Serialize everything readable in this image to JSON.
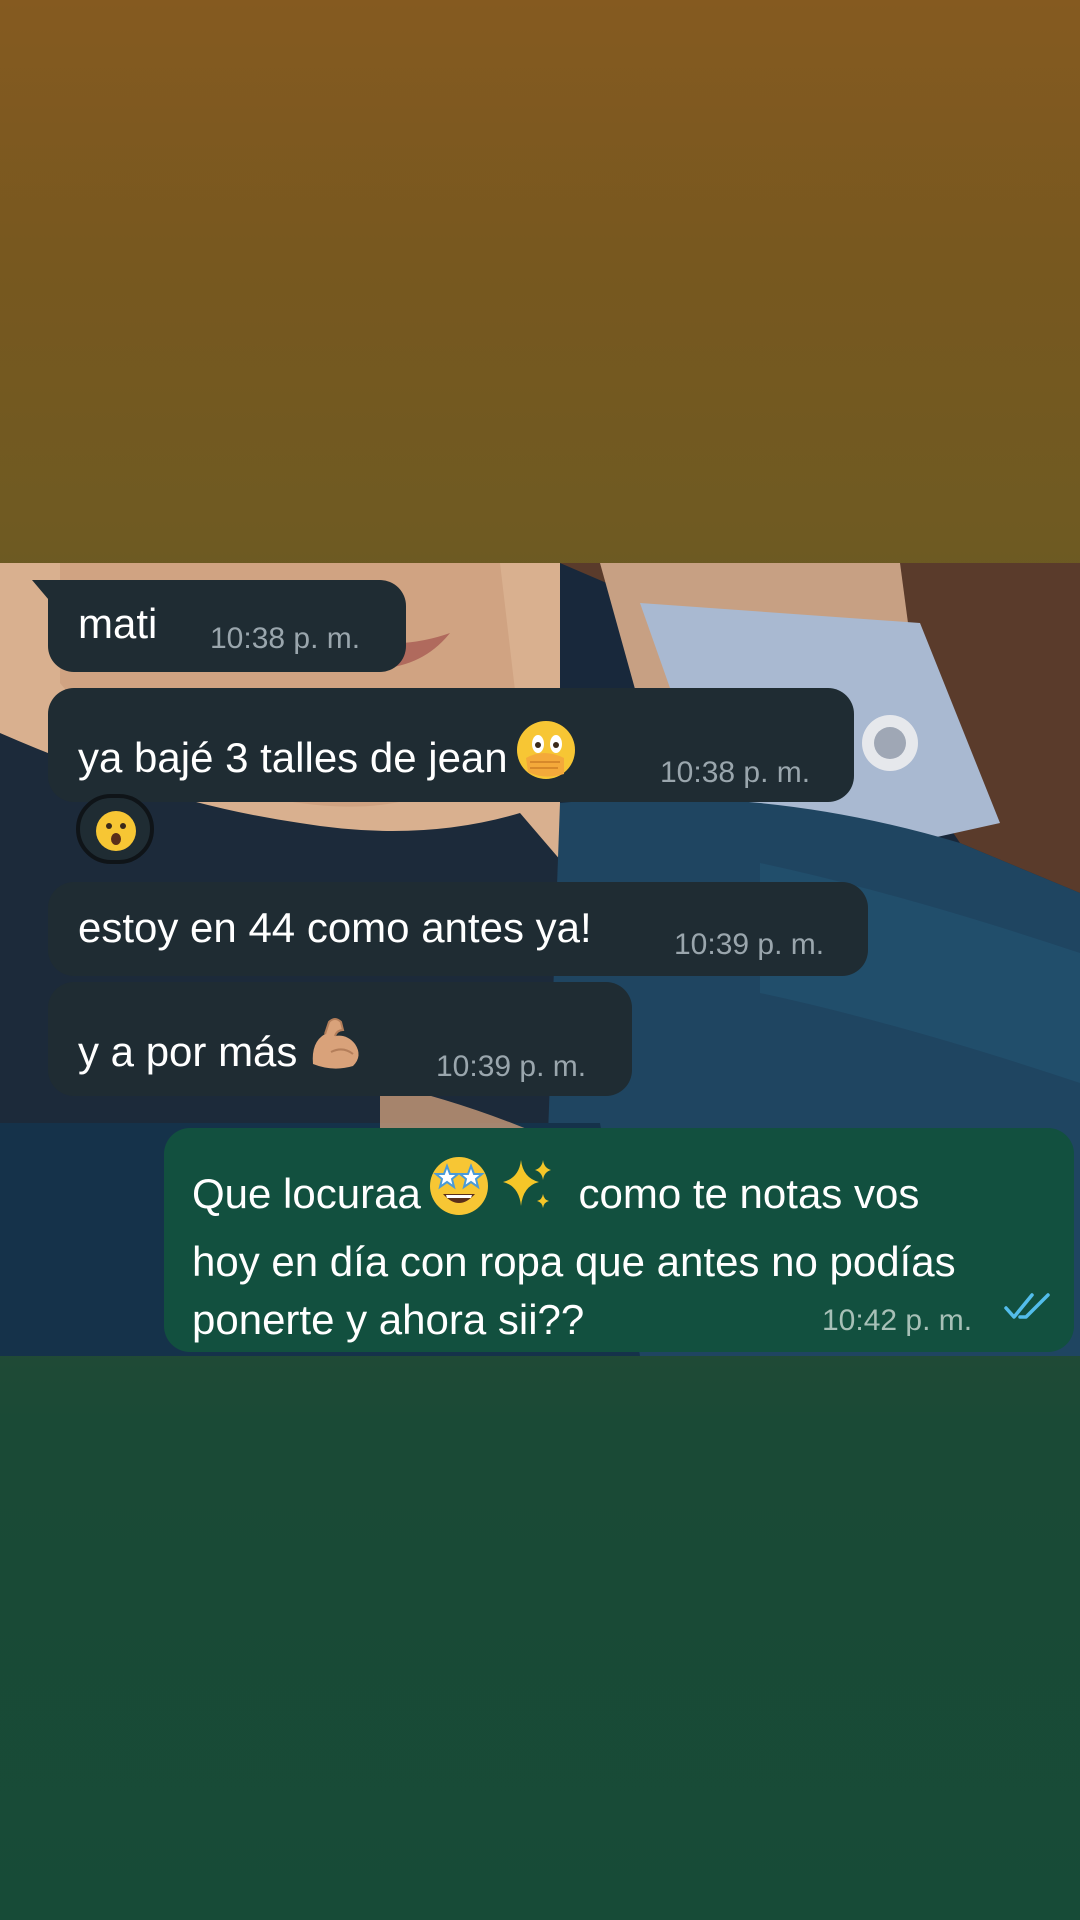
{
  "messages": [
    {
      "direction": "incoming",
      "text": "mati",
      "time": "10:38 p. m."
    },
    {
      "direction": "incoming",
      "text": "ya bajé 3 talles de jean",
      "emoji": "face-with-hand-over-mouth",
      "time": "10:38 p. m.",
      "reaction": "astonished-face"
    },
    {
      "direction": "incoming",
      "text": "estoy en 44 como antes ya!",
      "time": "10:39 p. m."
    },
    {
      "direction": "incoming",
      "text": "y a por más",
      "emoji": "flexed-biceps",
      "time": "10:39 p. m."
    },
    {
      "direction": "outgoing",
      "lines": [
        "Que locuraa",
        "hoy en día con ropa que antes no podías",
        "ponerte y ahora sii??"
      ],
      "line1_tail": "como te notas vos",
      "emojis": [
        "star-struck",
        "sparkles"
      ],
      "time": "10:42 p. m.",
      "status": "read"
    }
  ],
  "colors": {
    "incoming_bubble": "#1f2c33",
    "outgoing_bubble": "#12503f",
    "read_ticks": "#53bdeb"
  }
}
